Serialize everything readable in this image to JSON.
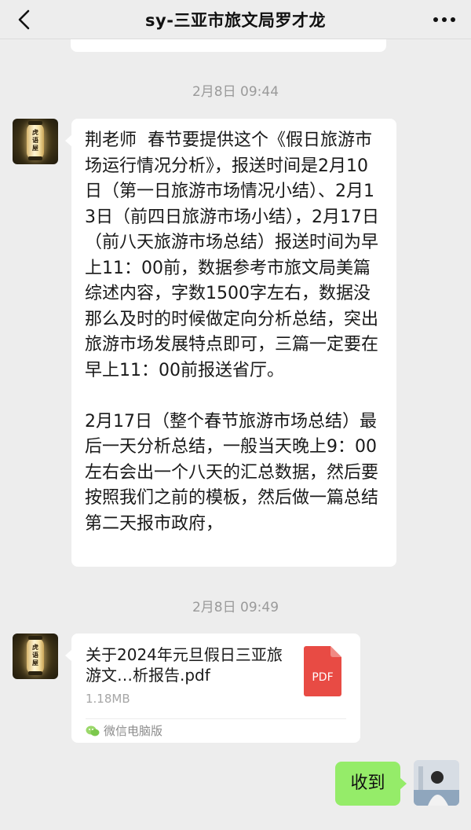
{
  "header": {
    "title": "sy-三亚市旅文局罗才龙",
    "back_icon": "chevron-left-icon",
    "more_icon": "more-dots-icon"
  },
  "messages": [
    {
      "timestamp": "2月8日 09:44",
      "sender": "left",
      "type": "text",
      "text": "荆老师  春节要提供这个《假日旅游市场运行情况分析》，报送时间是2月10日（第一日旅游市场情况小结）、2月13日（前四日旅游市场小结），2月17日（前八天旅游市场总结）报送时间为早上11：00前，数据参考市旅文局美篇综述内容，字数1500字左右，数据没那么及时的时候做定向分析总结，突出旅游市场发展特点即可，三篇一定要在早上11：00前报送省厅。\n\n2月17日（整个春节旅游市场总结）最后一天分析总结，一般当天晚上9：00左右会出一个八天的汇总数据，然后要按照我们之前的模板，然后做一篇总结第二天报市政府，"
    },
    {
      "timestamp": "2月8日 09:49",
      "sender": "left",
      "type": "file",
      "file_name": "关于2024年元旦假日三亚旅游文…析报告.pdf",
      "file_size": "1.18MB",
      "file_badge": "PDF",
      "file_source": "微信电脑版",
      "source_icon": "wechat-icon"
    },
    {
      "sender": "right",
      "type": "text",
      "text": "收到"
    }
  ],
  "avatar": {
    "lantern_text": "虎语屋"
  },
  "colors": {
    "background": "#ededed",
    "bubble_left": "#ffffff",
    "bubble_right": "#95ec69",
    "pdf_red": "#e84b44",
    "timestamp": "#9a9a9a"
  }
}
